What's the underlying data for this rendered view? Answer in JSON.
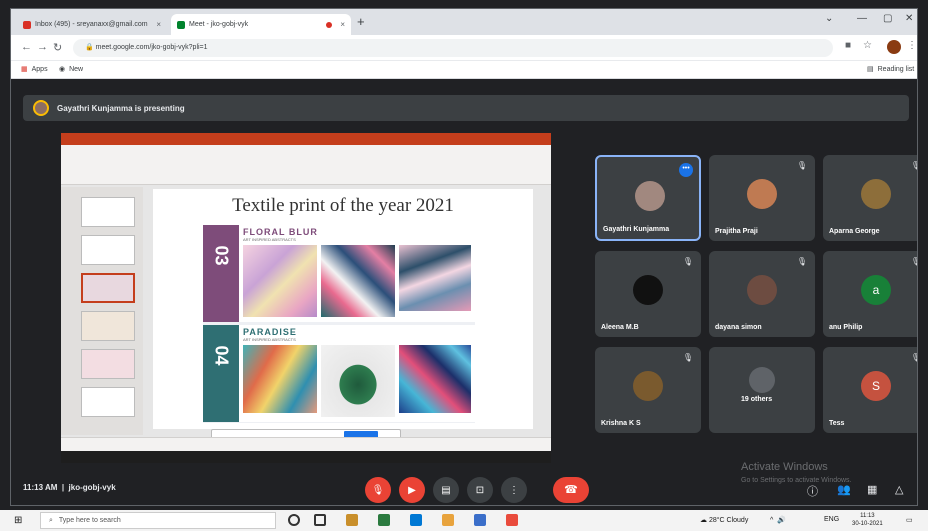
{
  "browser": {
    "tabs": [
      {
        "label": "Inbox (495) - sreyanaxx@gmail.com",
        "active": false
      },
      {
        "label": "Meet - jko-gobj-vyk",
        "active": true
      }
    ],
    "url": "meet.google.com/jko-gobj-vyk?pli=1",
    "bookmarks": [
      {
        "label": "Apps"
      },
      {
        "label": "New"
      }
    ],
    "reading_list": "Reading list"
  },
  "meet": {
    "presenting_text": "Gayathri Kunjamma is presenting",
    "time": "11:13 AM",
    "meeting_code": "jko-gobj-vyk",
    "participants": [
      {
        "name": "Gayathri Kunjamma",
        "initial": "",
        "avatar_color": "#a1887f",
        "active": true
      },
      {
        "name": "Prajitha Praji",
        "initial": "",
        "avatar_color": "#bf7a52",
        "active": false
      },
      {
        "name": "Aparna George",
        "initial": "",
        "avatar_color": "#8d6e3a",
        "active": false
      },
      {
        "name": "Aleena M.B",
        "initial": "",
        "avatar_color": "#111111",
        "active": false
      },
      {
        "name": "dayana simon",
        "initial": "",
        "avatar_color": "#6d4c41",
        "active": false
      },
      {
        "name": "anu Philip",
        "initial": "a",
        "avatar_color": "#188038",
        "active": false
      },
      {
        "name": "Krishna K S",
        "initial": "",
        "avatar_color": "#7a5a2e",
        "active": false
      },
      {
        "name": "19 others",
        "initial": "",
        "avatar_color": "#5f6368",
        "active": false
      },
      {
        "name": "Tess",
        "initial": "S",
        "avatar_color": "#c5523f",
        "active": false
      }
    ]
  },
  "slide": {
    "title": "Textile print of the year 2021",
    "collections": [
      {
        "number": "03",
        "name": "FLORAL BLUR",
        "subtitle": "ART INSPIRED ABSTRACTS",
        "color": "#7e4c7a",
        "title_color": "#7e4c7a"
      },
      {
        "number": "04",
        "name": "PARADISE",
        "subtitle": "ART INSPIRED ABSTRACTS",
        "color": "#2f6f73",
        "title_color": "#2f6f73"
      }
    ]
  },
  "watermark": {
    "line1": "Activate Windows",
    "line2": "Go to Settings to activate Windows."
  },
  "taskbar": {
    "search_placeholder": "Type here to search",
    "weather": "28°C Cloudy",
    "lang": "ENG",
    "clock_time": "11:13",
    "clock_date": "30-10-2021"
  }
}
